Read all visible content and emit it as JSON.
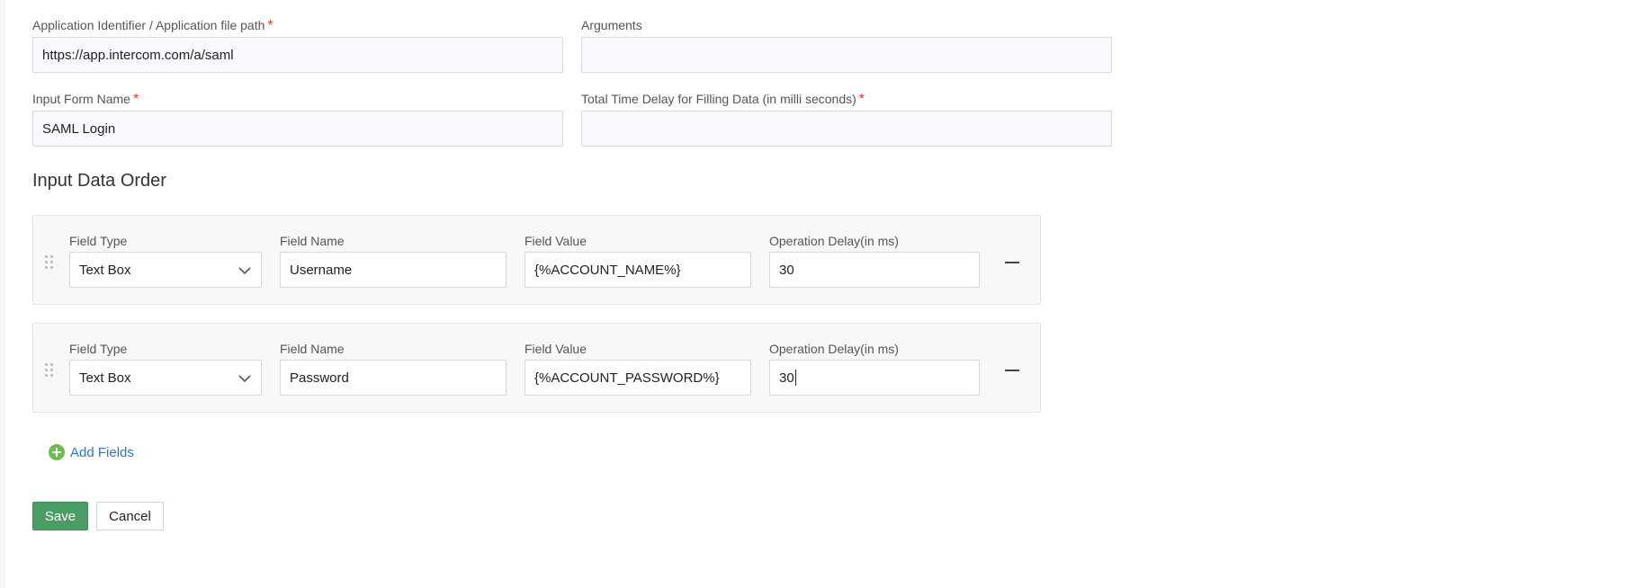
{
  "form": {
    "app_identifier": {
      "label": "Application Identifier / Application file path",
      "required_mark": "*",
      "value": "https://app.intercom.com/a/saml"
    },
    "arguments": {
      "label": "Arguments",
      "value": ""
    },
    "input_form_name": {
      "label": "Input Form Name",
      "required_mark": "*",
      "value": "SAML Login"
    },
    "total_time_delay": {
      "label": "Total Time Delay for Filling Data (in milli seconds)",
      "required_mark": "*",
      "value": ""
    }
  },
  "input_data_order": {
    "title": "Input Data Order",
    "column_labels": {
      "field_type": "Field Type",
      "field_name": "Field Name",
      "field_value": "Field Value",
      "operation_delay": "Operation Delay(in ms)"
    },
    "rows": [
      {
        "field_type": "Text Box",
        "field_name": "Username",
        "field_value": "{%ACCOUNT_NAME%}",
        "operation_delay": "30"
      },
      {
        "field_type": "Text Box",
        "field_name": "Password",
        "field_value": "{%ACCOUNT_PASSWORD%}",
        "operation_delay": "30"
      }
    ],
    "add_fields_label": "Add Fields",
    "icons": {
      "drag": "drag-handle-icon",
      "chevron": "chevron-down-icon",
      "remove": "minus-icon",
      "add": "plus-circle-icon"
    }
  },
  "actions": {
    "save_label": "Save",
    "cancel_label": "Cancel"
  },
  "colors": {
    "save_button": "#4a9d64",
    "add_icon": "#6cc04a",
    "link": "#2c78c8",
    "required": "#e53935"
  }
}
